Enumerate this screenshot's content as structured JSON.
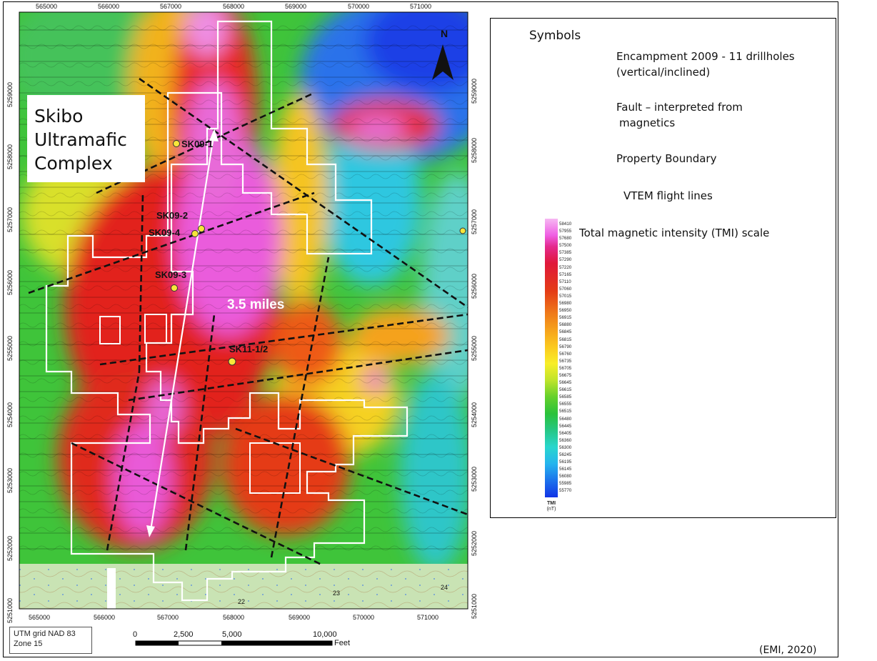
{
  "map": {
    "complex_label_lines": [
      "Skibo",
      "Ultramafic",
      "Complex"
    ],
    "distance_label": "3.5 miles",
    "north_label": "N",
    "easting_ticks": [
      "565000",
      "566000",
      "567000",
      "568000",
      "569000",
      "570000",
      "571000"
    ],
    "northing_ticks": [
      "5259000",
      "5258000",
      "5257000",
      "5256000",
      "5255000",
      "5254000",
      "5253000",
      "5252000",
      "5251000"
    ],
    "drillholes": [
      "SK09-1",
      "SK09-2",
      "SK09-4",
      "SK09-3",
      "SK11-1/2"
    ],
    "section_numbers": [
      "22",
      "23",
      "24"
    ]
  },
  "legend": {
    "title": "Symbols",
    "items": [
      {
        "icon": "drillhole-pin-icon",
        "lines": [
          "Encampment 2009 - 11 drillholes",
          "(vertical/inclined)"
        ]
      },
      {
        "icon": "dashed-fault-line-icon",
        "lines": [
          "Fault – interpreted from",
          "magnetics"
        ]
      },
      {
        "icon": "property-boundary-swatch-icon",
        "lines": [
          "Property Boundary"
        ]
      },
      {
        "icon": "flight-lines-icon",
        "lines": [
          "VTEM flight lines"
        ]
      },
      {
        "icon": "tmi-color-scale-icon",
        "lines": [
          "Total magnetic intensity (TMI) scale"
        ]
      }
    ],
    "tmi_values": [
      "58410",
      "57955",
      "57680",
      "57500",
      "57385",
      "57290",
      "57220",
      "57165",
      "57110",
      "57060",
      "57015",
      "56980",
      "56950",
      "56915",
      "56880",
      "56845",
      "56815",
      "56790",
      "56760",
      "56735",
      "56705",
      "56675",
      "56645",
      "56615",
      "56585",
      "56555",
      "56515",
      "56480",
      "56445",
      "56405",
      "56360",
      "56300",
      "56245",
      "56195",
      "56145",
      "56080",
      "55985",
      "55770"
    ],
    "tmi_caption": "TMI",
    "tmi_unit": "(nT)"
  },
  "scale_bar": {
    "values": [
      "0",
      "2,500",
      "5,000",
      "10,000"
    ],
    "unit": "Feet"
  },
  "grid_info": {
    "line1": "UTM grid NAD 83",
    "line2": "Zone 15"
  },
  "credit": "(EMI, 2020)",
  "colors": {
    "magenta_high": "#e64fd4",
    "red": "#e3231e",
    "yellow": "#f6e22a",
    "green": "#3fc43a",
    "blue_low": "#1a4ce8",
    "boundary": "#ffffff"
  }
}
